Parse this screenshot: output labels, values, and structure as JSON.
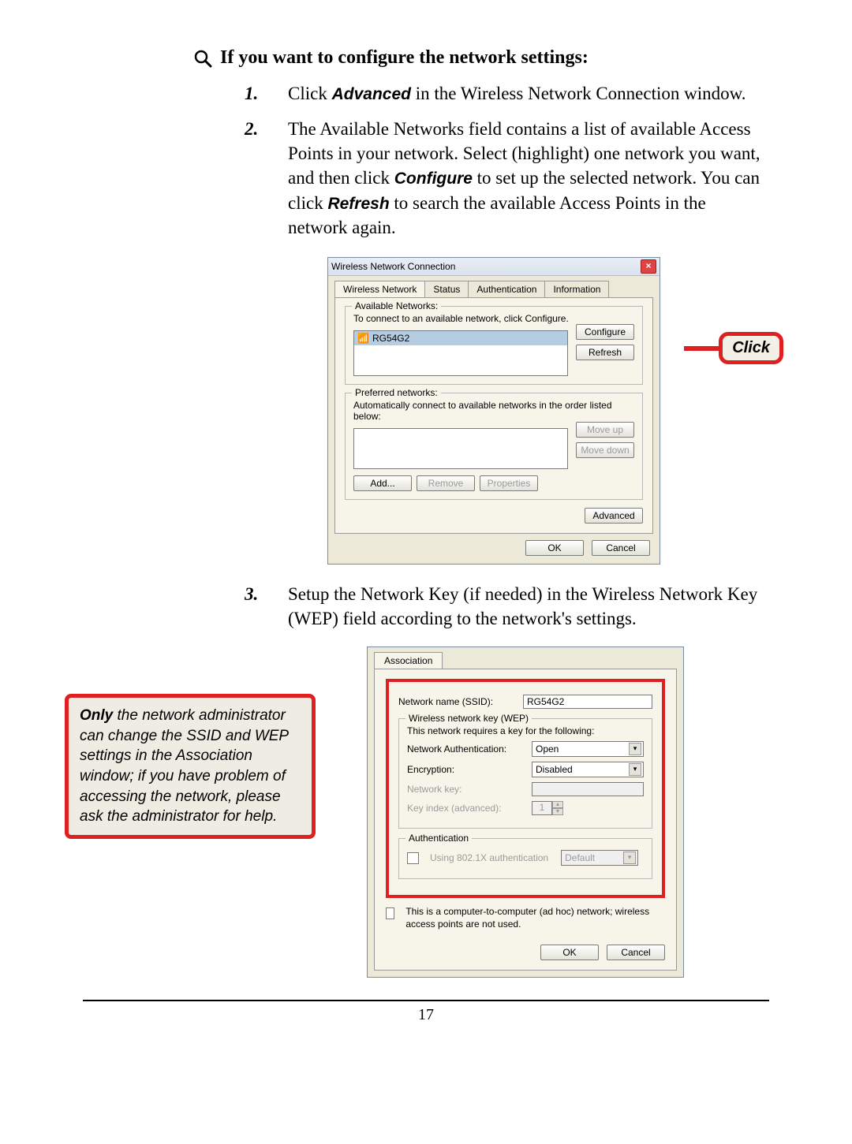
{
  "heading": "If you want to configure the network settings:",
  "steps": {
    "s1": {
      "num": "1.",
      "pre": "Click ",
      "term": "Advanced",
      "post": " in the Wireless Network Connection window."
    },
    "s2": {
      "num": "2.",
      "part1": "The Available Networks field contains a list of available Access Points in your network.  Select (highlight) one network you want, and then click ",
      "term1": "Configure",
      "part2": " to set up the selected network.  You can click ",
      "term2": "Refresh",
      "part3": " to search the available Access Points in the network again."
    },
    "s3": {
      "num": "3.",
      "text": "Setup the Network Key (if needed) in the Wireless Network Key (WEP) field according to the network's settings."
    }
  },
  "dialog1": {
    "title": "Wireless Network Connection",
    "tabs": [
      "Wireless Network",
      "Status",
      "Authentication",
      "Information"
    ],
    "group_available": {
      "label": "Available Networks:",
      "hint": "To connect to an available network, click Configure.",
      "item": "RG54G2",
      "btn_configure": "Configure",
      "btn_refresh": "Refresh"
    },
    "group_preferred": {
      "label": "Preferred networks:",
      "hint": "Automatically connect to available networks in the order listed below:",
      "btn_moveup": "Move up",
      "btn_movedown": "Move down",
      "btn_add": "Add...",
      "btn_remove": "Remove",
      "btn_properties": "Properties"
    },
    "btn_advanced": "Advanced",
    "btn_ok": "OK",
    "btn_cancel": "Cancel"
  },
  "click_label": "Click",
  "note": {
    "only": "Only",
    "text": " the network administrator can change the SSID and WEP settings in the Association window; if you have problem of accessing the network, please ask the administrator for help."
  },
  "dialog2": {
    "tab": "Association",
    "ssid_label": "Network name (SSID):",
    "ssid_value": "RG54G2",
    "wep_group": "Wireless network key (WEP)",
    "wep_hint": "This network requires a key for the following:",
    "auth_label": "Network Authentication:",
    "auth_value": "Open",
    "enc_label": "Encryption:",
    "enc_value": "Disabled",
    "key_label": "Network key:",
    "keyidx_label": "Key index (advanced):",
    "keyidx_value": "1",
    "authn_group": "Authentication",
    "authn_check": "Using 802.1X authentication",
    "authn_value": "Default",
    "adhoc": "This is a computer-to-computer (ad hoc) network; wireless access points are not used.",
    "btn_ok": "OK",
    "btn_cancel": "Cancel"
  },
  "page_number": "17"
}
